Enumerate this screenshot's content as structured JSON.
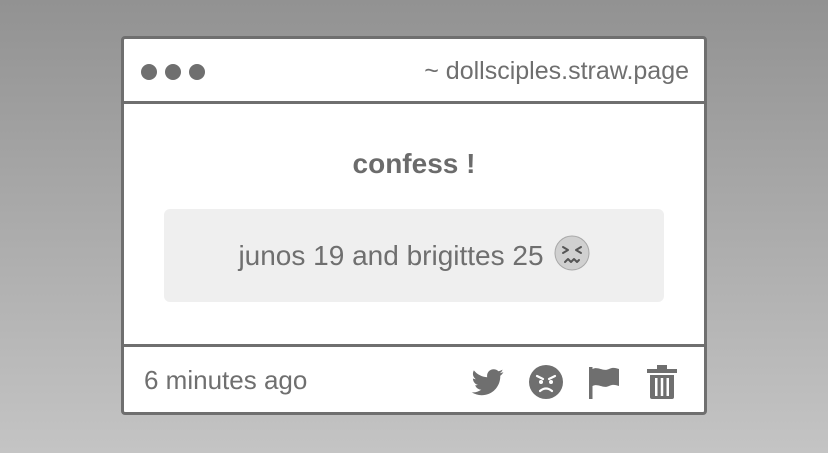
{
  "window": {
    "url": "~ dollsciples.straw.page"
  },
  "main": {
    "heading": "confess !",
    "message": "junos 19 and brigittes 25",
    "message_emoji": "persevering-face-emoji"
  },
  "footer": {
    "timestamp": "6 minutes ago",
    "actions": [
      {
        "icon": "twitter-icon"
      },
      {
        "icon": "angry-face-icon"
      },
      {
        "icon": "flag-icon"
      },
      {
        "icon": "trash-icon"
      }
    ]
  },
  "colors": {
    "border": "#6f6f6f",
    "card_background": "#ffffff",
    "message_background": "#efefef"
  }
}
